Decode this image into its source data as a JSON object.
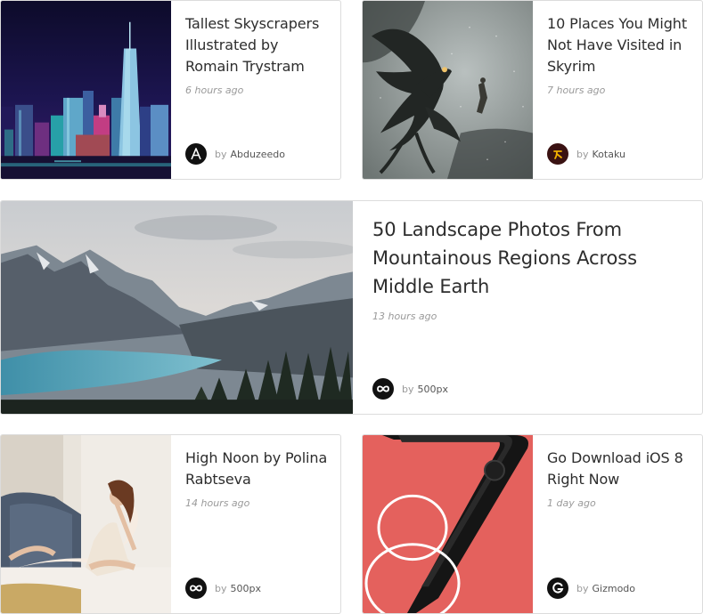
{
  "cards": [
    {
      "title": "Tallest Skyscrapers Illustrated by Romain Trystram",
      "time": "6 hours ago",
      "by": "by",
      "source": "Abduzeedo",
      "logo_icon": "abduzeedo-a-icon"
    },
    {
      "title": "10 Places You Might Not Have Visited in Skyrim",
      "time": "7 hours ago",
      "by": "by",
      "source": "Kotaku",
      "logo_icon": "kotaku-k-icon"
    },
    {
      "title": "50 Landscape Photos From Mountainous Regions Across Middle Earth",
      "time": "13 hours ago",
      "by": "by",
      "source": "500px",
      "logo_icon": "infinity-icon"
    },
    {
      "title": "High Noon by Polina Rabtseva",
      "time": "14 hours ago",
      "by": "by",
      "source": "500px",
      "logo_icon": "infinity-icon"
    },
    {
      "title": "Go Download iOS 8 Right Now",
      "time": "1 day ago",
      "by": "by",
      "source": "Gizmodo",
      "logo_icon": "gizmodo-g-icon"
    }
  ],
  "colors": {
    "card_border": "#dcdcdc",
    "title": "#2d2d2d",
    "time": "#9a9a9a",
    "kotaku_logo_bg": "#3a1212",
    "kotaku_logo_fg": "#f2b000",
    "ios_bg": "#e4615d"
  }
}
